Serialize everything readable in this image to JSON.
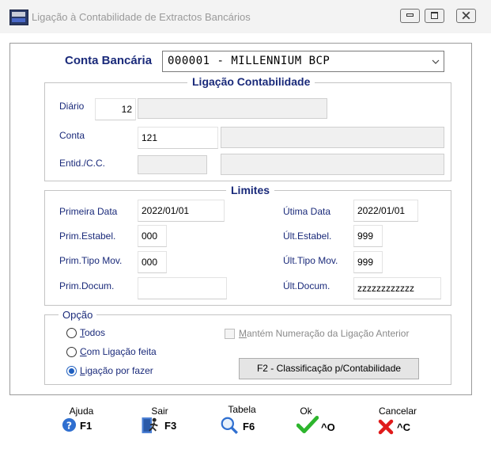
{
  "window": {
    "title": "Ligação à Contabilidade de Extractos Bancários",
    "icon_name": "app-logo-icon"
  },
  "conta_bancaria": {
    "label": "Conta Bancária",
    "value": "000001 - MILLENNIUM BCP"
  },
  "ligacao": {
    "legend": "Ligação Contabilidade",
    "diario_label": "Diário",
    "diario_value": "12",
    "diario_desc": "",
    "conta_label": "Conta",
    "conta_value": "121",
    "conta_desc": "",
    "entid_label": "Entid./C.C.",
    "entid_value": "",
    "entid_desc": ""
  },
  "limites": {
    "legend": "Limites",
    "primeira_data_label": "Primeira Data",
    "primeira_data_value": "2022/01/01",
    "ultima_data_label": "Útima Data",
    "ultima_data_value": "2022/01/01",
    "prim_estabel_label": "Prim.Estabel.",
    "prim_estabel_value": "000",
    "ult_estabel_label": "Últ.Estabel.",
    "ult_estabel_value": "999",
    "prim_tipo_label": "Prim.Tipo Mov.",
    "prim_tipo_value": "000",
    "ult_tipo_label": "Últ.Tipo Mov.",
    "ult_tipo_value": "999",
    "prim_docum_label": "Prim.Docum.",
    "prim_docum_value": "",
    "ult_docum_label": "Últ.Docum.",
    "ult_docum_value": "zzzzzzzzzzzz"
  },
  "opcao": {
    "legend": "Opção",
    "todos_key": "T",
    "todos_rest": "odos",
    "com_key": "C",
    "com_rest": "om Ligação feita",
    "por_key": "L",
    "por_rest": "igação por fazer",
    "selected": "por_fazer",
    "mantem_key": "M",
    "mantem_rest": "antém Numeração da Ligação Anterior",
    "f2_button": "F2 - Classificação p/Contabilidade"
  },
  "toolbar": {
    "ajuda_label": "Ajuda",
    "ajuda_key": "F1",
    "sair_label": "Sair",
    "sair_key": "F3",
    "tabela_label": "Tabela",
    "tabela_key": "F6",
    "ok_label": "Ok",
    "ok_key": "^O",
    "cancelar_label": "Cancelar",
    "cancelar_key": "^C"
  },
  "colors": {
    "label_blue": "#1a2a7a",
    "radio_blue": "#1f5fbf",
    "ok_green": "#2db52d",
    "cancel_red": "#e01a1a"
  }
}
